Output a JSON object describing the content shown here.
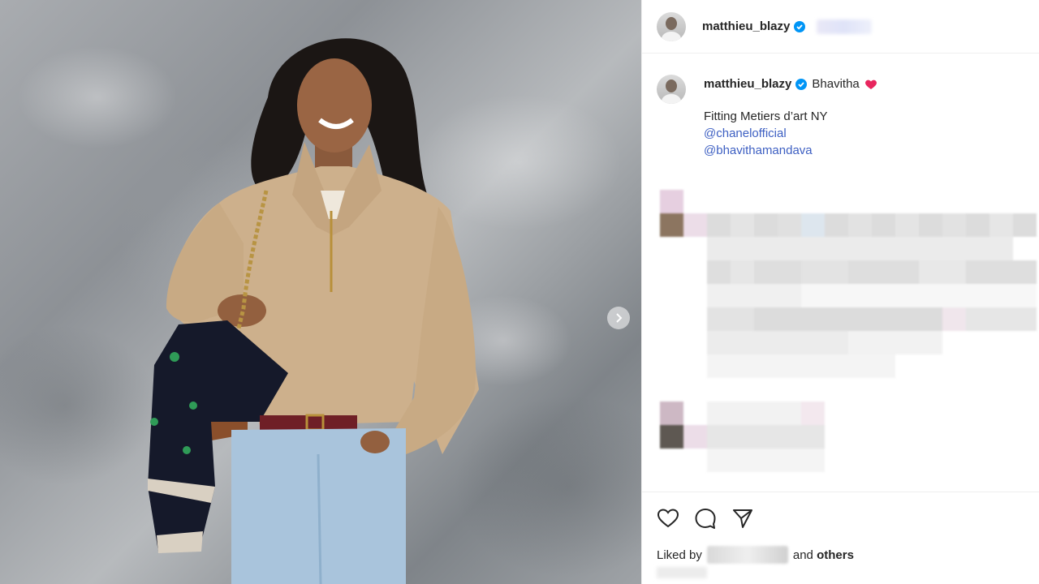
{
  "header": {
    "username": "matthieu_blazy"
  },
  "caption": {
    "username": "matthieu_blazy",
    "tagged_name": "Bhavitha",
    "text": "Fitting Metiers d’art NY",
    "mentions": [
      "@chanelofficial",
      "@bhavithamandava"
    ]
  },
  "actions": {
    "liked_prefix": "Liked by",
    "liked_and": "and",
    "liked_others": "others"
  },
  "colors": {
    "link": "#3d5fc2",
    "verified": "#0095f6",
    "heart": "#e8265e",
    "divider": "#efefef"
  },
  "icons": [
    "verified-badge-icon",
    "heart-emoji-icon",
    "like-heart-icon",
    "comment-icon",
    "share-icon",
    "next-arrow-icon"
  ]
}
